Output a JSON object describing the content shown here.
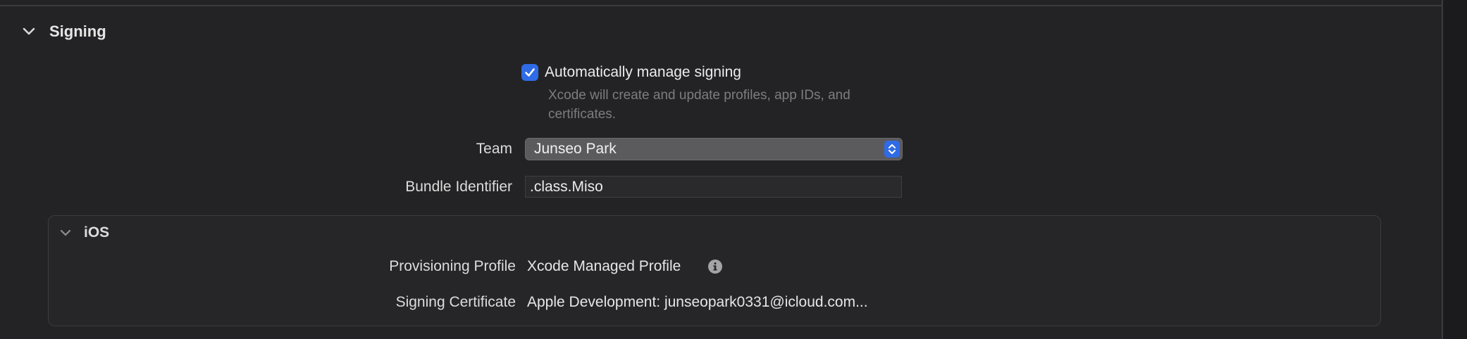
{
  "signing": {
    "section_title": "Signing",
    "auto_manage": {
      "label": "Automatically manage signing",
      "checked": true,
      "helper_text": "Xcode will create and update profiles, app IDs, and certificates."
    },
    "team": {
      "label": "Team",
      "value": "Junseo Park"
    },
    "bundle_identifier": {
      "label": "Bundle Identifier",
      "value": ".class.Miso"
    },
    "ios": {
      "title": "iOS",
      "provisioning_profile": {
        "label": "Provisioning Profile",
        "value": "Xcode Managed Profile"
      },
      "signing_certificate": {
        "label": "Signing Certificate",
        "value": "Apple Development: junseopark0331@icloud.com..."
      }
    }
  },
  "colors": {
    "accent": "#2f6be6",
    "background": "#232325"
  },
  "icons": {
    "section_disclosure": "chevron-down-icon",
    "ios_disclosure": "chevron-down-icon",
    "checkbox": "checkmark-icon",
    "popup": "up-down-chevron-icon",
    "info": "info-icon"
  }
}
